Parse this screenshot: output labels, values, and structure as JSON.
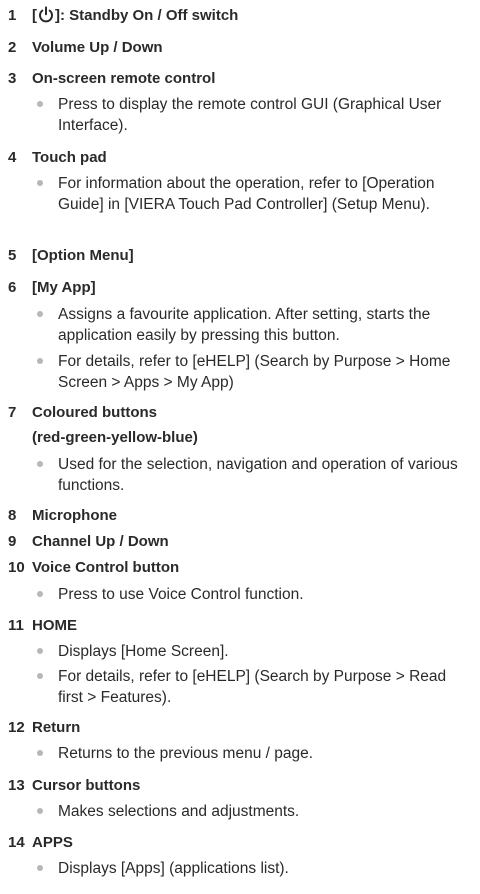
{
  "items": [
    {
      "num": "1",
      "pre": "[",
      "post": "]: Standby On / Off switch",
      "icon": "power-icon"
    },
    {
      "num": "2",
      "title": "Volume Up / Down"
    },
    {
      "num": "3",
      "title": "On-screen remote control",
      "bullets": [
        "Press to display the remote control GUI (Graphical User Interface)."
      ]
    },
    {
      "num": "4",
      "title": "Touch pad",
      "bullets": [
        "For information about the operation, refer to [Operation Guide] in [VIERA Touch Pad Controller] (Setup Menu)."
      ]
    },
    {
      "num": "5",
      "title": "[Option Menu]"
    },
    {
      "num": "6",
      "title": "[My App]",
      "bullets": [
        "Assigns a favourite application. After setting, starts the application easily by pressing this button.",
        "For details, refer to [eHELP] (Search by Purpose > Home Screen > Apps > My App)"
      ]
    },
    {
      "num": "7",
      "title": "Coloured buttons",
      "subtitle": "(red-green-yellow-blue)",
      "bullets": [
        "Used for the selection, navigation and operation of various functions."
      ]
    },
    {
      "num": "8",
      "title": "Microphone"
    },
    {
      "num": "9",
      "title": "Channel Up / Down"
    },
    {
      "num": "10",
      "title": "Voice Control button",
      "bullets": [
        "Press to use Voice Control function."
      ]
    },
    {
      "num": "11",
      "title": "HOME",
      "bullets": [
        "Displays [Home Screen].",
        "For details, refer to [eHELP] (Search by Purpose > Read first > Features)."
      ]
    },
    {
      "num": "12",
      "title": "Return",
      "bullets": [
        "Returns to the previous menu / page."
      ]
    },
    {
      "num": "13",
      "title": "Cursor buttons",
      "bullets": [
        "Makes selections and adjustments."
      ]
    },
    {
      "num": "14",
      "title": "APPS",
      "bullets": [
        "Displays [Apps] (applications list)."
      ]
    }
  ]
}
